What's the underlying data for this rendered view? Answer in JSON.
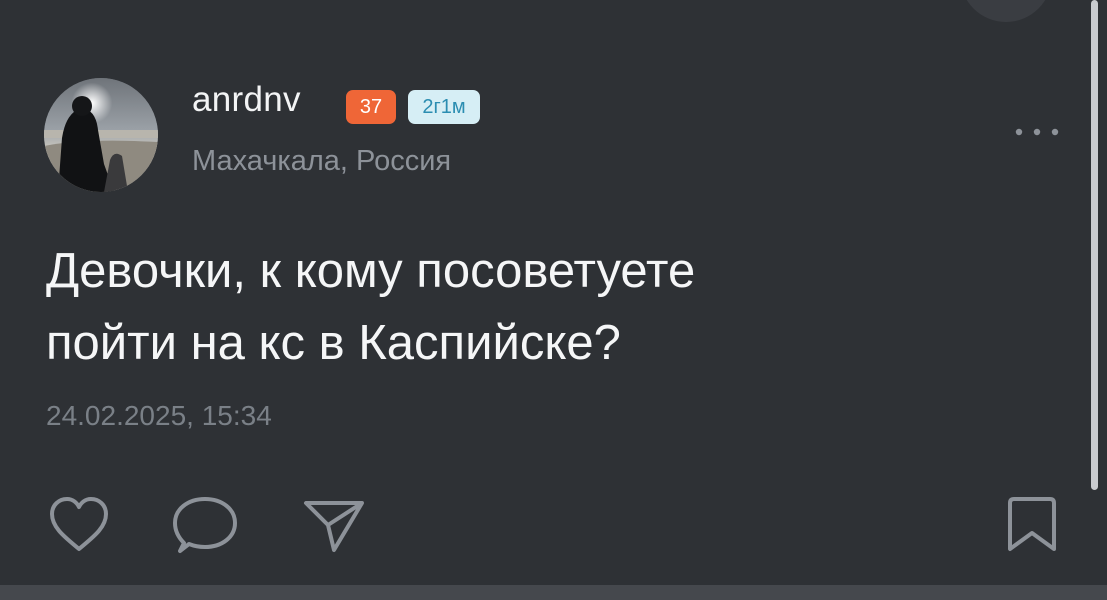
{
  "post": {
    "author": {
      "username": "anrdnv",
      "badges": [
        {
          "label": "37",
          "color": "#ef6637"
        },
        {
          "label": "2г1м",
          "color": "#d6eef5"
        }
      ],
      "location": "Махачкала, Россия",
      "avatar_icon": "avatar-photo"
    },
    "text_lines": [
      "Девочки, к кому посоветуете",
      "пойти на кс в Каспийске?"
    ],
    "timestamp": "24.02.2025, 15:34",
    "actions": {
      "like_icon": "heart-icon",
      "comment_icon": "comment-icon",
      "share_icon": "share-icon",
      "bookmark_icon": "bookmark-icon",
      "more_icon": "more-icon"
    }
  },
  "theme": {
    "background": "#2e3135",
    "text": "#f5f6f7",
    "secondary": "#8d9299"
  }
}
